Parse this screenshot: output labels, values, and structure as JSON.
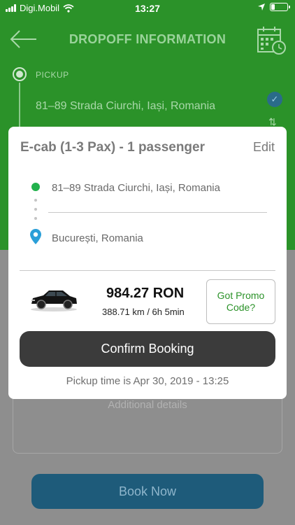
{
  "status_bar": {
    "carrier": "Digi.Mobil",
    "time": "13:27",
    "battery_level": 0.25,
    "icons": [
      "signal-icon",
      "wifi-icon",
      "location-arrow-icon",
      "battery-icon"
    ]
  },
  "header": {
    "title": "DROPOFF INFORMATION",
    "icons": [
      "back-arrow-icon",
      "calendar-clock-icon"
    ]
  },
  "pickup": {
    "label": "PICKUP",
    "address": "81–89 Strada Ciurchi, Iași, Romania"
  },
  "booking_card": {
    "title": "E-cab (1-3 Pax) - 1 passenger",
    "edit_label": "Edit",
    "from_address": "81–89 Strada Ciurchi, Iași, Romania",
    "to_address": "București, Romania",
    "price": "984.27 RON",
    "distance_duration": "388.71 km / 6h 5min",
    "promo_label": "Got Promo Code?",
    "confirm_label": "Confirm Booking",
    "pickup_time": "Pickup time is Apr 30, 2019 - 13:25"
  },
  "form": {
    "details_placeholder": "Additional details",
    "book_label": "Book Now"
  },
  "colors": {
    "header_green": "#2b9229",
    "confirm_dark": "#3b3b3b",
    "book_blue": "#1e5b7a",
    "promo_green": "#2b9229",
    "origin_dot": "#22b14c",
    "destination_pin": "#2a9fd8"
  }
}
